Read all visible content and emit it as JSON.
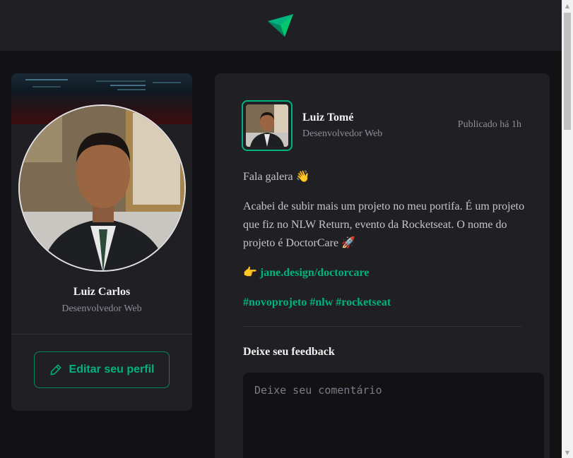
{
  "header": {
    "logo_icon": "ignite-logo-icon"
  },
  "profile": {
    "name": "Luiz Carlos",
    "role": "Desenvolvedor Web",
    "edit_label": "Editar seu perfil",
    "edit_icon": "pencil-icon"
  },
  "post": {
    "author": "Luiz Tomé",
    "author_role": "Desenvolvedor Web",
    "published": "Publicado há 1h",
    "paragraph1": "Fala galera 👋",
    "paragraph2": "Acabei de subir mais um projeto no meu portifa. É um projeto que fiz no NLW Return, evento da Rocketseat. O nome do projeto é DoctorCare 🚀",
    "link_prefix": "👉 ",
    "link_text": "jane.design/doctorcare",
    "hashtags": "#novoprojeto #nlw #rocketseat",
    "feedback_title": "Deixe seu feedback",
    "comment_placeholder": "Deixe seu comentário"
  },
  "colors": {
    "accent": "#00b37e",
    "accent_border": "#00875f",
    "background": "#121214",
    "card": "#202024"
  }
}
